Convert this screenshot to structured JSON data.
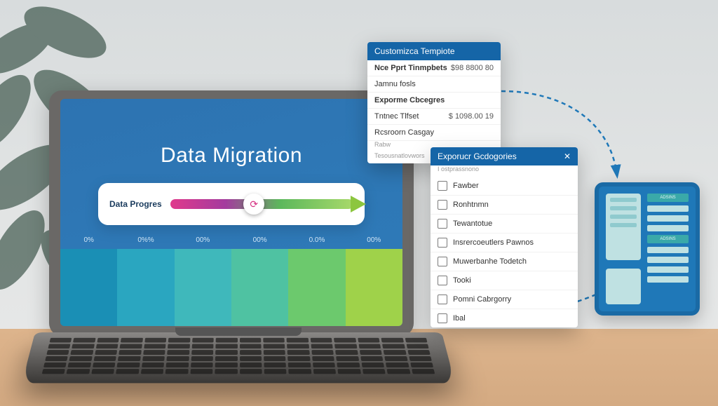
{
  "screen": {
    "title": "Data Migration",
    "progress_label": "Data Progres",
    "info_icon": "i"
  },
  "chart_data": {
    "type": "bar",
    "title": "Data Migration",
    "categories": [
      "0%",
      "0%%",
      "00%",
      "00%",
      "0.0%",
      "00%"
    ],
    "values": [
      100,
      100,
      100,
      100,
      100,
      100
    ],
    "colors": [
      "#1a8fb5",
      "#2aa6c0",
      "#3fb8bb",
      "#4fc2a2",
      "#6cc96d",
      "#9fd24a"
    ],
    "xlabel": "",
    "ylabel": "",
    "ylim": [
      0,
      100
    ]
  },
  "panel_a": {
    "title": "Customizca Tempiote",
    "rows": [
      {
        "k": "Nce Pprt Tinmpbets",
        "v": "$98 8800 80",
        "strong": true
      },
      {
        "k": "Jamnu fosls",
        "v": ""
      },
      {
        "k": "Exporme Cbcegres",
        "v": "",
        "strong": true
      },
      {
        "k": "Tntnec Tlfset",
        "v": "$ 1098.00 19"
      },
      {
        "k": "Rcsroorn Casgay",
        "v": ""
      }
    ],
    "sub1": "Rabw",
    "sub2": "Tesousnatlovwors"
  },
  "panel_b": {
    "title": "Exporucr Gcdogories",
    "close": "✕",
    "sub": "I ostprassnono",
    "items": [
      "Fawber",
      "Ronhtnmn",
      "Tewantotue",
      "Insrercoeutlers Pawnos",
      "Muwerbanhe Todetch",
      "Tooki",
      "Pomni Cabrgorry",
      "Ibal"
    ]
  },
  "tablet": {
    "header1": "ADSINS",
    "header2": "ADSINS"
  }
}
